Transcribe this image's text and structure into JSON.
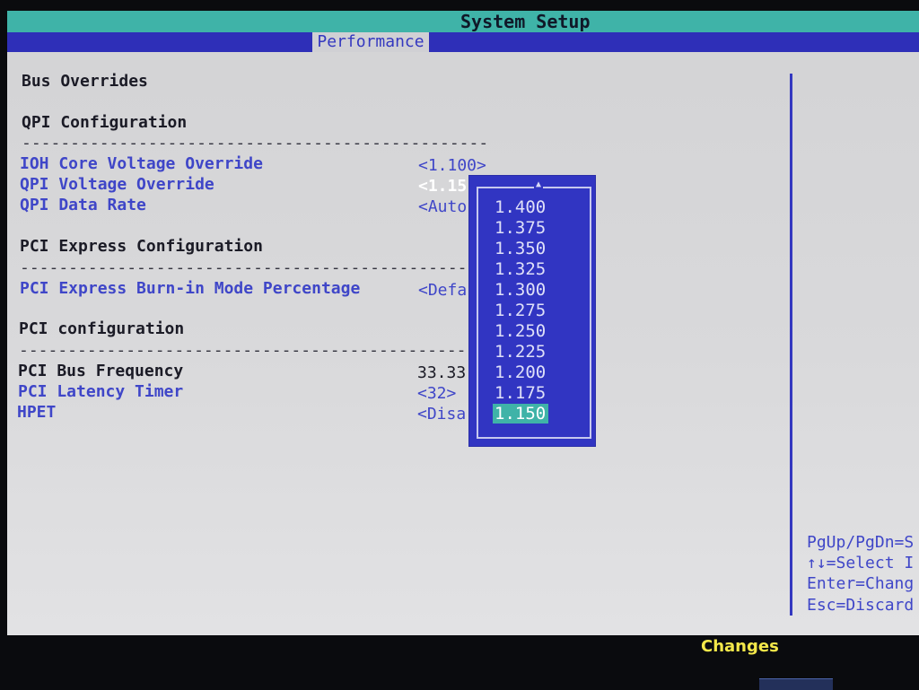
{
  "app": {
    "title": "System Setup",
    "active_tab": "Performance"
  },
  "sections": {
    "bus_overrides": "Bus Overrides",
    "qpi_config": "QPI Configuration",
    "pci_express_config": "PCI Express Configuration",
    "pci_config": "PCI configuration",
    "divider": "------------------------------------------------"
  },
  "settings": {
    "ioh_core_voltage": {
      "label": "IOH Core Voltage Override",
      "value": "<1.100>"
    },
    "qpi_voltage": {
      "label": "QPI Voltage Override",
      "value": "<1.15"
    },
    "qpi_data_rate": {
      "label": "QPI Data Rate",
      "value": "<Auto"
    },
    "pcie_burn_in": {
      "label": "PCI Express Burn-in Mode Percentage",
      "value": "<Defa"
    },
    "pci_bus_freq": {
      "label": "PCI Bus Frequency",
      "value": "33.33"
    },
    "pci_latency": {
      "label": "PCI Latency Timer",
      "value": "<32>"
    },
    "hpet": {
      "label": "HPET",
      "value": "<Disa"
    }
  },
  "popup": {
    "arrow": "▲",
    "options": [
      "1.400",
      "1.375",
      "1.350",
      "1.325",
      "1.300",
      "1.275",
      "1.250",
      "1.225",
      "1.200",
      "1.175",
      "1.150"
    ],
    "selected": "1.150"
  },
  "help": {
    "pgup": "PgUp/PgDn=S",
    "select": "↑↓=Select I",
    "enter": "Enter=Chang",
    "esc": "Esc=Discard"
  },
  "footer": {
    "changes": "Changes"
  },
  "colors": {
    "title_bar": "#3fb3a8",
    "tab_bar": "#2e2fb8",
    "popup_bg": "#3135c2",
    "selected_bg": "#3fb3a8",
    "changes_text": "#f4e84a"
  }
}
